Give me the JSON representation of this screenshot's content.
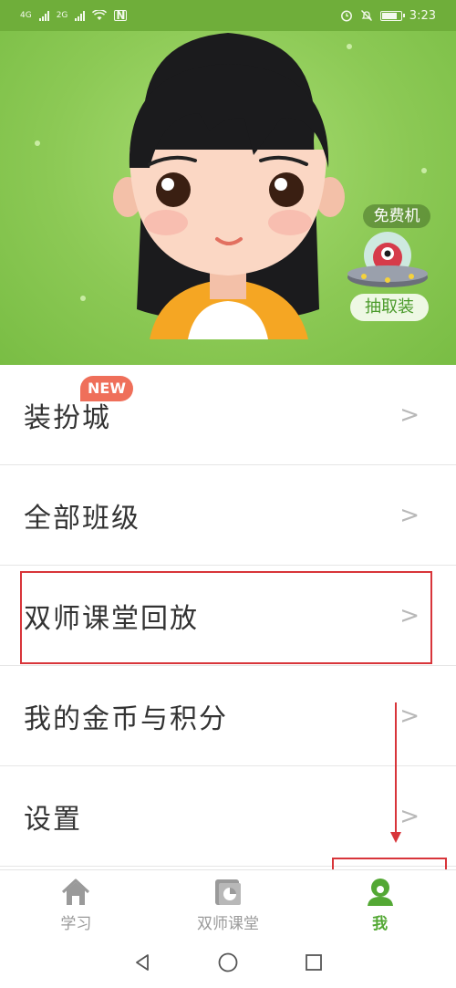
{
  "status_bar": {
    "sim1": "4G",
    "sim2": "2G",
    "time": "3:23",
    "battery_level": 0.85
  },
  "hero": {
    "promo_top": "免费机",
    "promo_bottom": "抽取装",
    "colors": {
      "background": "#8cc955",
      "promo_text": "#4a9a2a"
    }
  },
  "menu": {
    "items": [
      {
        "label": "装扮城",
        "badge": "NEW"
      },
      {
        "label": "全部班级"
      },
      {
        "label": "双师课堂回放"
      },
      {
        "label": "我的金币与积分"
      },
      {
        "label": "设置"
      }
    ],
    "chevron": ">"
  },
  "tabbar": {
    "tabs": [
      {
        "label": "学习",
        "icon": "home-icon",
        "active": false
      },
      {
        "label": "双师课堂",
        "icon": "classroom-icon",
        "active": false
      },
      {
        "label": "我",
        "icon": "user-icon",
        "active": true
      }
    ],
    "active_color": "#53a834",
    "inactive_color": "#9a9a9a"
  },
  "navbar": {
    "icons": [
      "back-icon",
      "home-circle-icon",
      "recents-icon"
    ]
  },
  "annotation_color": "#d8353a"
}
